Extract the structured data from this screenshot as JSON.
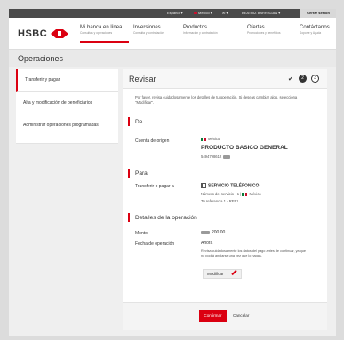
{
  "topbar": {
    "language": "Español",
    "country": "México",
    "user": "BEATRIZ BARRAGAN",
    "logout": "Cerrar sesión"
  },
  "header": {
    "logo": "HSBC",
    "nav": [
      {
        "title": "Mi banca en línea",
        "sub": "Consultas y operaciones"
      },
      {
        "title": "Inversiones",
        "sub": "Consulta y contratación"
      },
      {
        "title": "Productos",
        "sub": "Información y contratación"
      },
      {
        "title": "Ofertas",
        "sub": "Promociones y beneficios"
      },
      {
        "title": "Contáctanos",
        "sub": "Soporte y Ayuda"
      }
    ]
  },
  "page_title": "Operaciones",
  "sidebar": {
    "items": [
      {
        "label": "Transferir y pagar"
      },
      {
        "label": "Alta y modificación de beneficiarios"
      },
      {
        "label": "Administrar operaciones programadas"
      }
    ]
  },
  "panel": {
    "title": "Revisar",
    "steps": {
      "step2": "2",
      "step3": "3"
    },
    "intro": "Por favor, revisa cuidadosamente los detalles de tu operación. Si deseas cambiar algo, selecciona \"Modificar\".",
    "de": {
      "title": "De",
      "label": "Cuenta de origen",
      "country": "México",
      "product": "PRODUCTO BASICO GENERAL",
      "account": "5494798612"
    },
    "para": {
      "title": "Para",
      "label": "Transferir o pagar a",
      "service": "SERVICIO TELÉFONICO",
      "service_line": "Número del servicio - 1 |",
      "service_country": "México",
      "reference": "Tu referencia 1 - REF1"
    },
    "detalles": {
      "title": "Detalles de la operación",
      "amount_label": "Monto",
      "amount": "200.00",
      "date_label": "Fecha de operación",
      "date": "Ahora",
      "note": "Revisa cuidadosamente los datos del pago antes de continuar, ya que no podrá anularse una vez que lo hagas."
    },
    "modify": "Modificar",
    "confirm": "Confirmar",
    "cancel": "Cancelar"
  }
}
